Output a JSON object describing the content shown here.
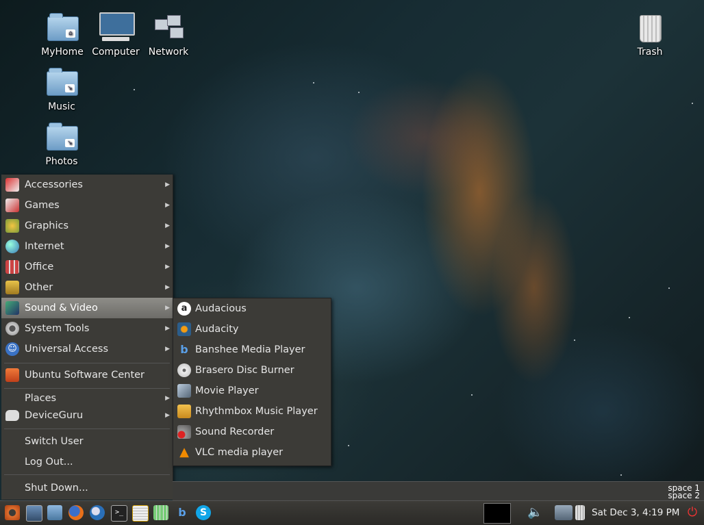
{
  "desktop_icons": {
    "myhome": "MyHome",
    "computer": "Computer",
    "network": "Network",
    "trash": "Trash",
    "music": "Music",
    "photos": "Photos"
  },
  "menu": {
    "items": [
      {
        "label": "Accessories",
        "icon": "accessories-icon"
      },
      {
        "label": "Games",
        "icon": "games-icon"
      },
      {
        "label": "Graphics",
        "icon": "graphics-icon"
      },
      {
        "label": "Internet",
        "icon": "internet-icon"
      },
      {
        "label": "Office",
        "icon": "office-icon"
      },
      {
        "label": "Other",
        "icon": "other-icon"
      },
      {
        "label": "Sound & Video",
        "icon": "sound-video-icon",
        "selected": true
      },
      {
        "label": "System Tools",
        "icon": "system-tools-icon"
      },
      {
        "label": "Universal Access",
        "icon": "universal-access-icon"
      }
    ],
    "software_center": "Ubuntu Software Center",
    "places": "Places",
    "deviceguru": "DeviceGuru",
    "switch_user": "Switch User",
    "log_out": "Log Out...",
    "shut_down": "Shut Down..."
  },
  "submenu": {
    "items": [
      {
        "label": "Audacious",
        "icon": "audacious-icon"
      },
      {
        "label": "Audacity",
        "icon": "audacity-icon"
      },
      {
        "label": "Banshee Media Player",
        "icon": "banshee-icon"
      },
      {
        "label": "Brasero Disc Burner",
        "icon": "brasero-icon"
      },
      {
        "label": "Movie Player",
        "icon": "movie-player-icon"
      },
      {
        "label": "Rhythmbox Music Player",
        "icon": "rhythmbox-icon"
      },
      {
        "label": "Sound Recorder",
        "icon": "sound-recorder-icon"
      },
      {
        "label": "VLC media player",
        "icon": "vlc-icon"
      }
    ]
  },
  "workspaces": {
    "space1": "space 1",
    "space2": "space 2"
  },
  "panel": {
    "clock": "Sat Dec  3,  4:19 PM"
  },
  "colors": {
    "menu_bg": "#3c3b37",
    "selected": "#7d7c78",
    "panel_bg": "#33322f"
  }
}
